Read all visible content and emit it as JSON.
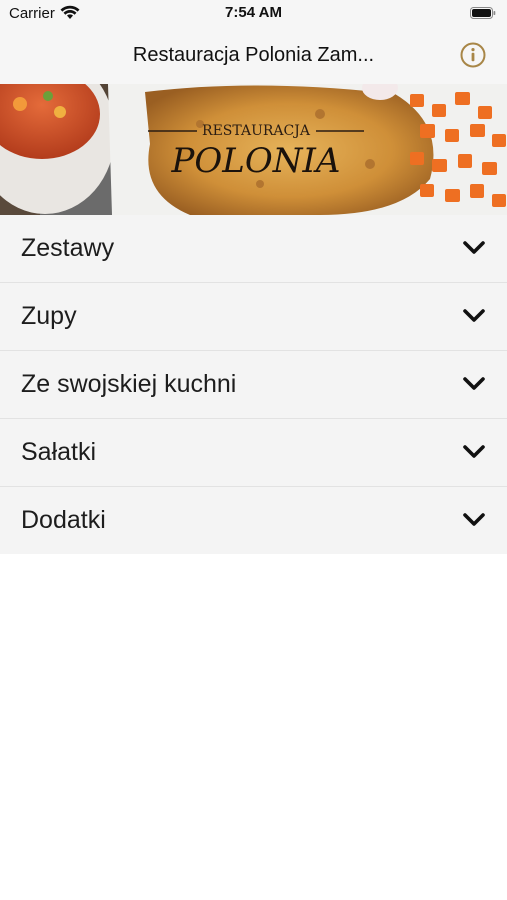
{
  "status_bar": {
    "carrier": "Carrier",
    "time": "7:54 AM"
  },
  "nav": {
    "title": "Restauracja Polonia Zam...",
    "info_icon": "info-icon"
  },
  "banner": {
    "logo_top": "RESTAURACJA",
    "logo_main": "POLONIA"
  },
  "menu": {
    "items": [
      {
        "label": "Zestawy"
      },
      {
        "label": "Zupy"
      },
      {
        "label": "Ze swojskiej kuchni"
      },
      {
        "label": "Sałatki"
      },
      {
        "label": "Dodatki"
      }
    ]
  },
  "colors": {
    "accent": "#a88647",
    "list_bg": "#f4f4f4",
    "bar_bg": "#f6f6f6"
  }
}
